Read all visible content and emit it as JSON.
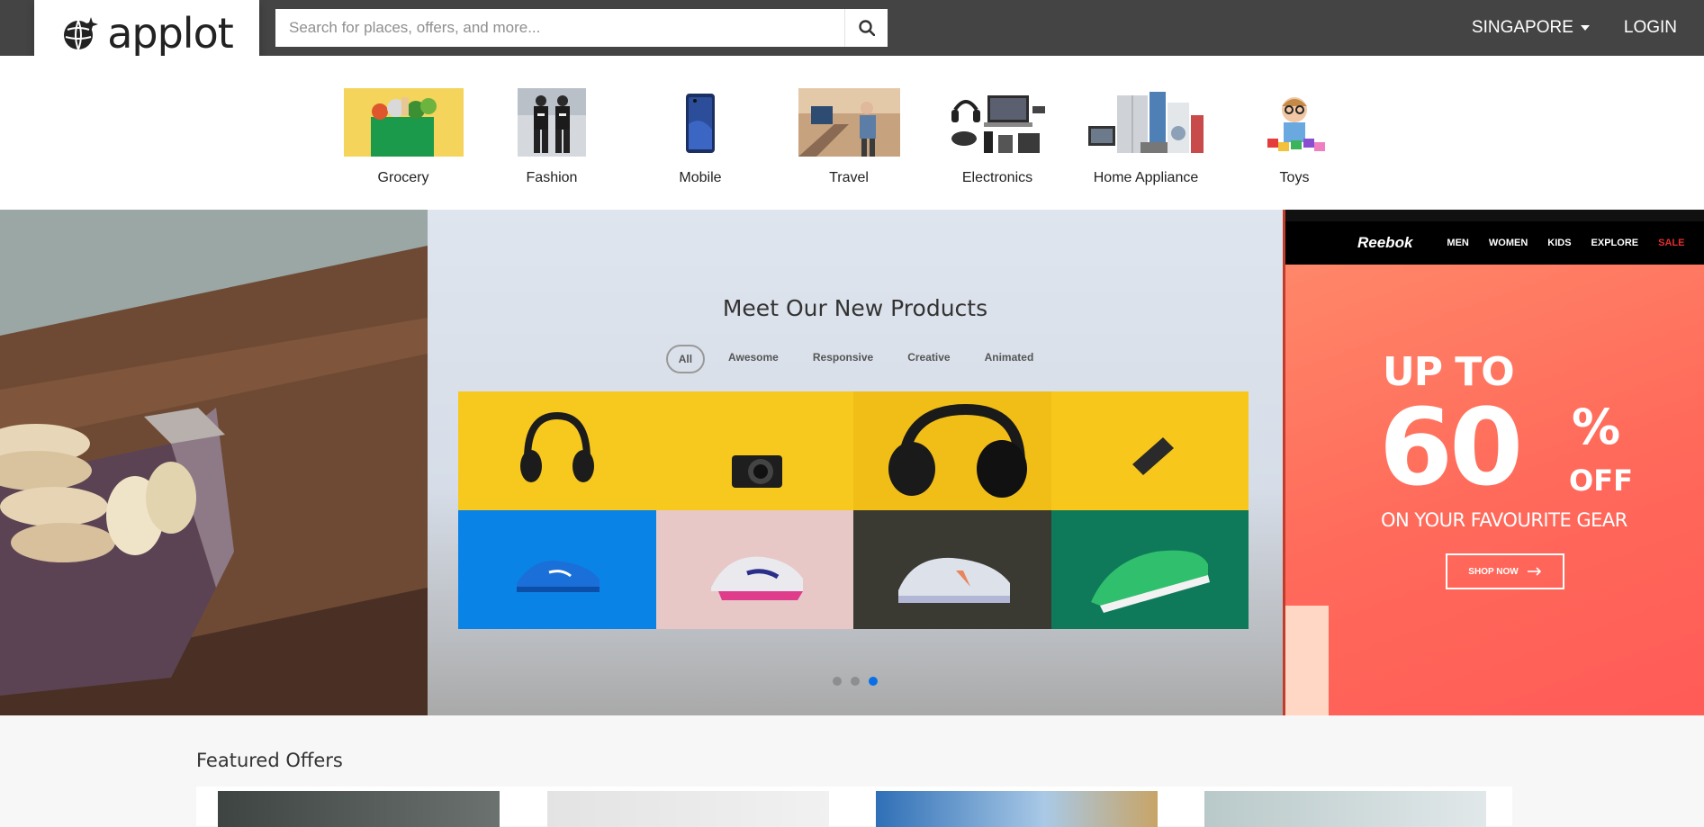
{
  "header": {
    "logo_text": "applot",
    "search_placeholder": "Search for places, offers, and more...",
    "region": "SINGAPORE",
    "login": "LOGIN"
  },
  "categories": [
    {
      "label": "Grocery",
      "icon": "grocery-bag-icon"
    },
    {
      "label": "Fashion",
      "icon": "fashion-icon"
    },
    {
      "label": "Mobile",
      "icon": "mobile-phone-icon"
    },
    {
      "label": "Travel",
      "icon": "travel-icon"
    },
    {
      "label": "Electronics",
      "icon": "electronics-icon"
    },
    {
      "label": "Home Appliance",
      "icon": "home-appliance-icon"
    },
    {
      "label": "Toys",
      "icon": "toys-icon"
    }
  ],
  "hero": {
    "center": {
      "title": "Meet Our New Products",
      "filters": [
        "All",
        "Awesome",
        "Responsive",
        "Creative",
        "Animated"
      ],
      "active_filter": "All"
    },
    "right": {
      "brand": "Reebok",
      "nav": [
        "MEN",
        "WOMEN",
        "KIDS",
        "EXPLORE",
        "SALE"
      ],
      "line1": "UP TO",
      "big": "60",
      "pct": "%",
      "off": "OFF",
      "sub": "ON YOUR FAVOURITE GEAR",
      "cta": "SHOP NOW"
    },
    "dots": 3,
    "active_dot": 3
  },
  "featured": {
    "title": "Featured Offers"
  }
}
